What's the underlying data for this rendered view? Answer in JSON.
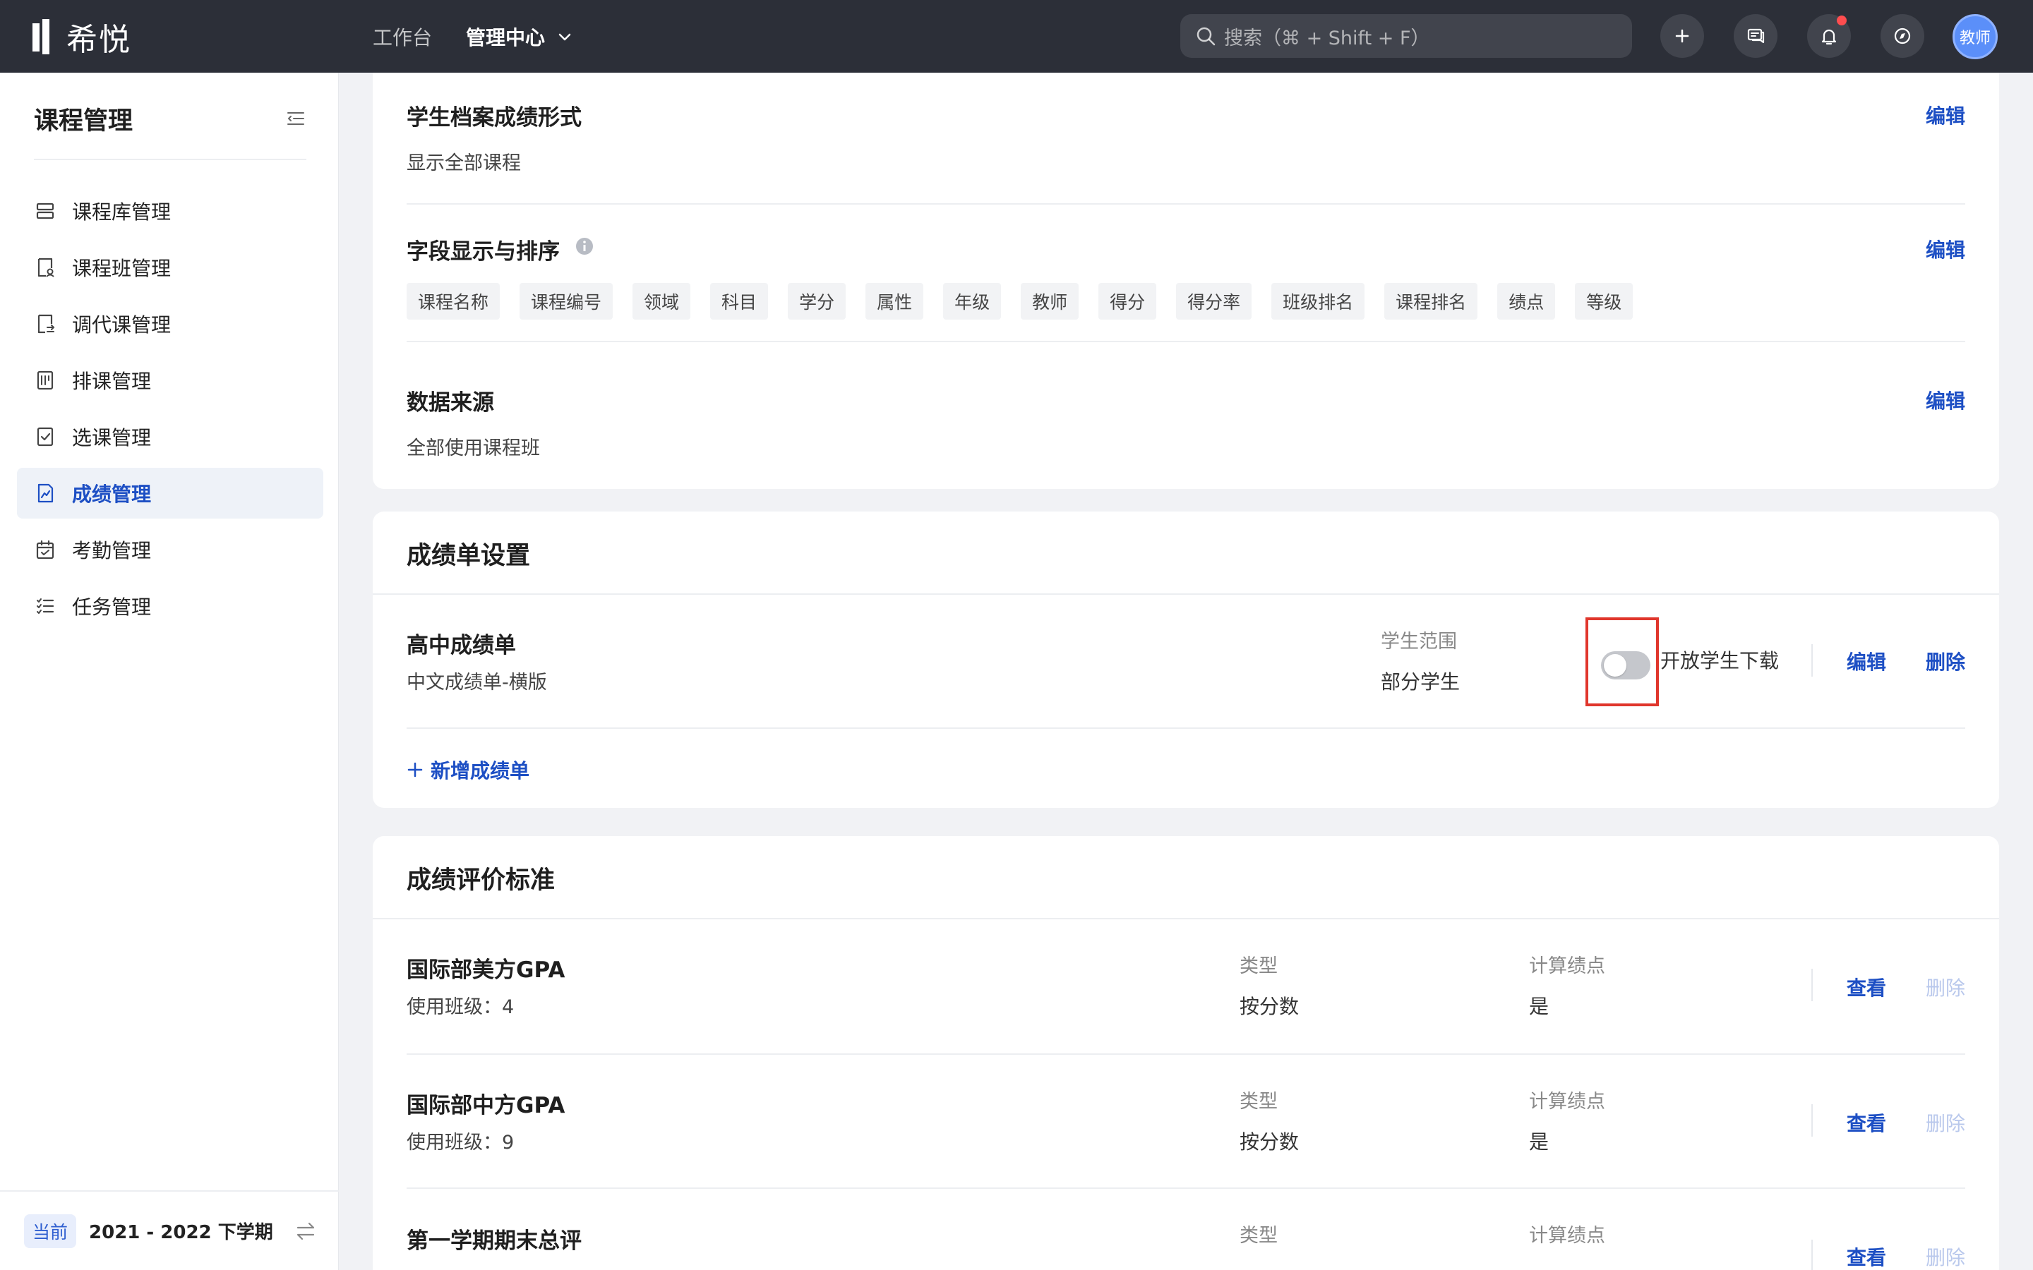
{
  "topbar": {
    "logo_text": "希悦",
    "nav": {
      "workbench": "工作台",
      "admin": "管理中心"
    },
    "search_placeholder": "搜索（⌘ + Shift + F）",
    "avatar_label": "教师",
    "notification_dot_color": "#ff4d4f"
  },
  "sidebar": {
    "title": "课程管理",
    "items": [
      {
        "label": "课程库管理",
        "icon": "course-library-icon"
      },
      {
        "label": "课程班管理",
        "icon": "course-class-icon"
      },
      {
        "label": "调代课管理",
        "icon": "substitute-icon"
      },
      {
        "label": "排课管理",
        "icon": "schedule-icon"
      },
      {
        "label": "选课管理",
        "icon": "selection-icon"
      },
      {
        "label": "成绩管理",
        "icon": "grade-icon",
        "active": true
      },
      {
        "label": "考勤管理",
        "icon": "calendar-icon"
      },
      {
        "label": "任务管理",
        "icon": "task-list-icon"
      }
    ],
    "term_badge": "当前",
    "term_text": "2021 - 2022 下学期"
  },
  "profile_settings": {
    "archive_format": {
      "title": "学生档案成绩形式",
      "value": "显示全部课程",
      "edit": "编辑"
    },
    "fields": {
      "title": "字段显示与排序",
      "edit": "编辑",
      "tags": [
        "课程名称",
        "课程编号",
        "领域",
        "科目",
        "学分",
        "属性",
        "年级",
        "教师",
        "得分",
        "得分率",
        "班级排名",
        "课程排名",
        "绩点",
        "等级"
      ]
    },
    "data_source": {
      "title": "数据来源",
      "value": "全部使用课程班",
      "edit": "编辑"
    }
  },
  "report_settings": {
    "title": "成绩单设置",
    "report": {
      "name": "高中成绩单",
      "template": "中文成绩单-横版",
      "scope_label": "学生范围",
      "scope_value": "部分学生",
      "toggle_label": "开放学生下载",
      "toggle_on": false,
      "edit": "编辑",
      "delete": "删除"
    },
    "add_label": "新增成绩单"
  },
  "criteria": {
    "title": "成绩评价标准",
    "type_label": "类型",
    "gpa_label": "计算绩点",
    "view": "查看",
    "delete": "删除",
    "rows": [
      {
        "name": "国际部美方GPA",
        "classes": "使用班级：4",
        "type": "按分数",
        "gpa": "是"
      },
      {
        "name": "国际部中方GPA",
        "classes": "使用班级：9",
        "type": "按分数",
        "gpa": "是"
      },
      {
        "name": "第一学期期末总评",
        "classes": "",
        "type": "",
        "gpa": ""
      }
    ]
  }
}
